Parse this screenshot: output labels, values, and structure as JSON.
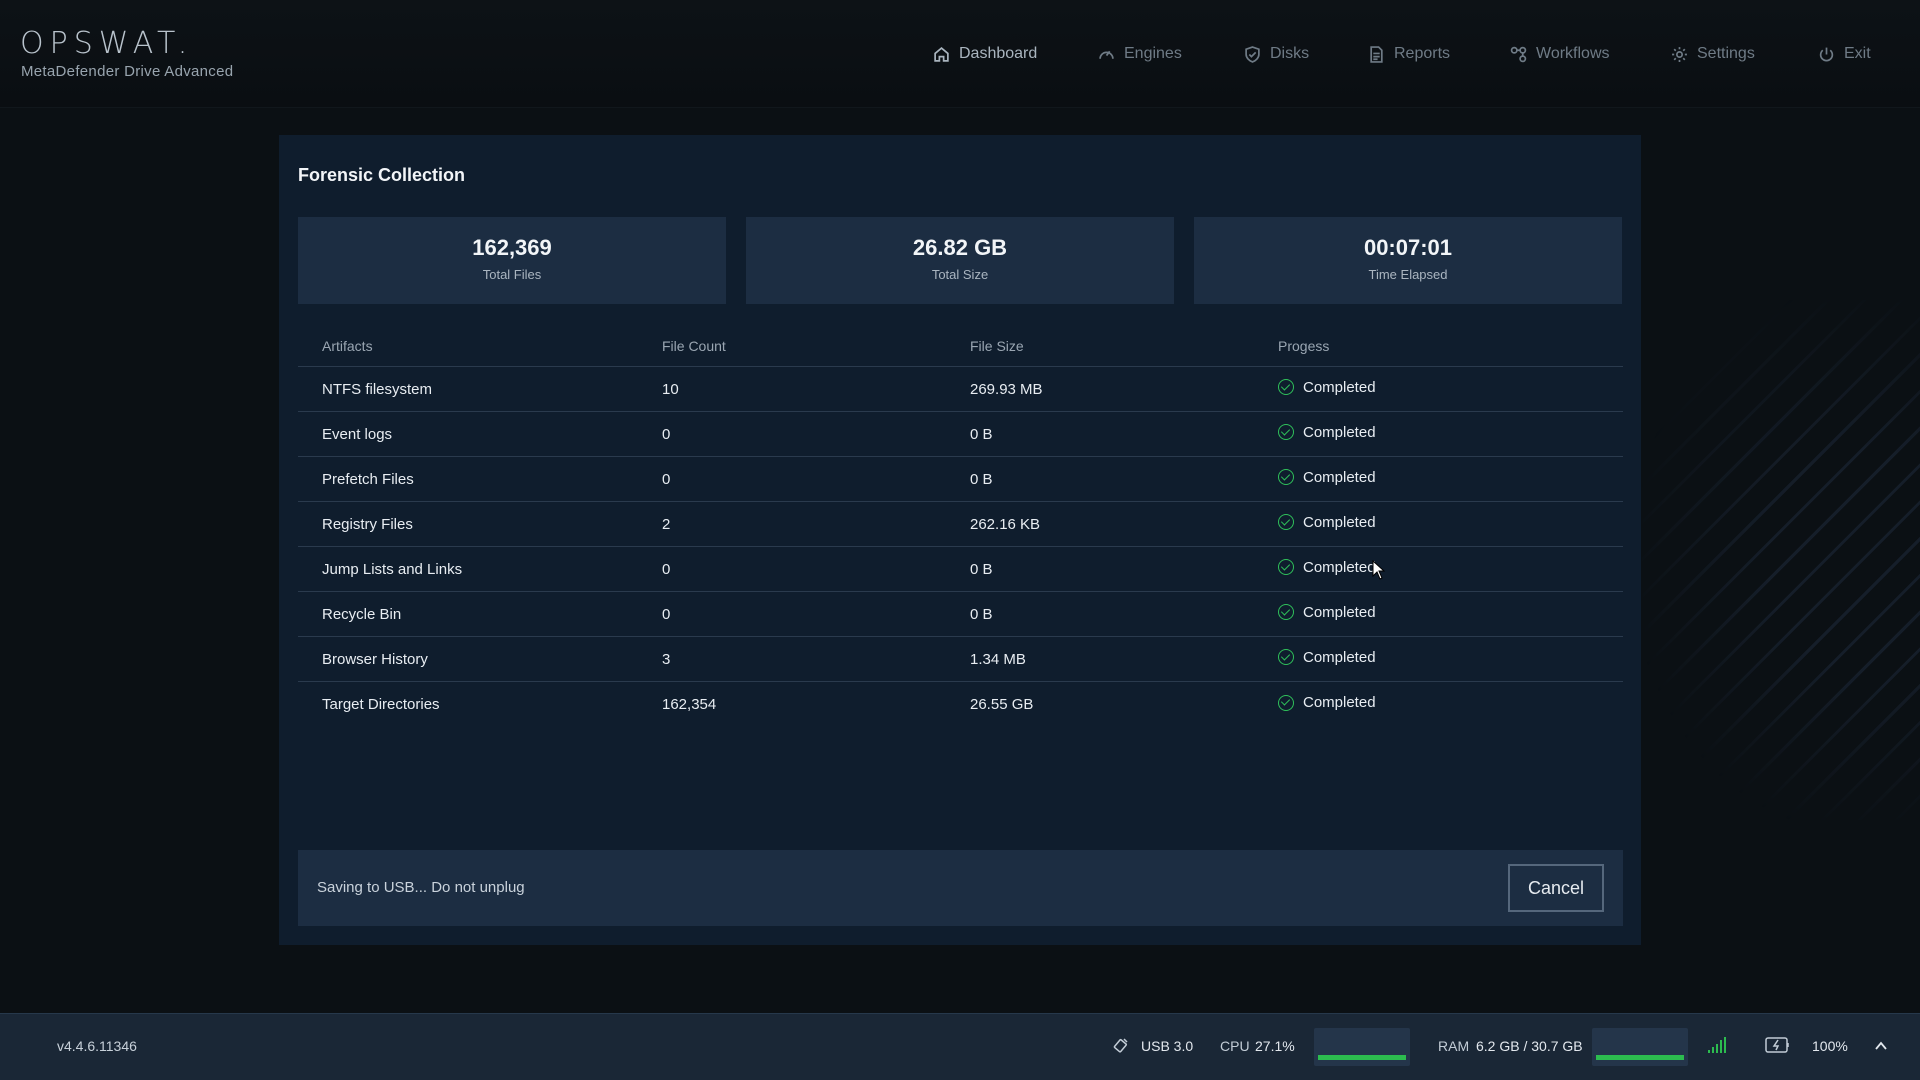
{
  "app": {
    "logo": "OPSWAT.",
    "subtitle": "MetaDefender Drive Advanced"
  },
  "nav": [
    {
      "label": "Dashboard",
      "icon": "home-icon",
      "active": true
    },
    {
      "label": "Engines",
      "icon": "gauge-icon",
      "active": false
    },
    {
      "label": "Disks",
      "icon": "shield-check-icon",
      "active": false
    },
    {
      "label": "Reports",
      "icon": "document-icon",
      "active": false
    },
    {
      "label": "Workflows",
      "icon": "workflow-icon",
      "active": false
    },
    {
      "label": "Settings",
      "icon": "gear-icon",
      "active": false
    },
    {
      "label": "Exit",
      "icon": "power-icon",
      "active": false
    }
  ],
  "panel": {
    "title": "Forensic Collection",
    "stats": [
      {
        "value": "162,369",
        "label": "Total Files"
      },
      {
        "value": "26.82 GB",
        "label": "Total Size"
      },
      {
        "value": "00:07:01",
        "label": "Time Elapsed"
      }
    ],
    "table": {
      "headers": [
        "Artifacts",
        "File Count",
        "File Size",
        "Progess"
      ],
      "rows": [
        {
          "artifact": "NTFS filesystem",
          "count": "10",
          "size": "269.93 MB",
          "status": "Completed"
        },
        {
          "artifact": "Event logs",
          "count": "0",
          "size": "0 B",
          "status": "Completed"
        },
        {
          "artifact": "Prefetch Files",
          "count": "0",
          "size": "0 B",
          "status": "Completed"
        },
        {
          "artifact": "Registry Files",
          "count": "2",
          "size": "262.16 KB",
          "status": "Completed"
        },
        {
          "artifact": "Jump Lists and Links",
          "count": "0",
          "size": "0 B",
          "status": "Completed"
        },
        {
          "artifact": "Recycle Bin",
          "count": "0",
          "size": "0 B",
          "status": "Completed"
        },
        {
          "artifact": "Browser History",
          "count": "3",
          "size": "1.34 MB",
          "status": "Completed"
        },
        {
          "artifact": "Target Directories",
          "count": "162,354",
          "size": "26.55 GB",
          "status": "Completed"
        }
      ]
    },
    "footer": {
      "message": "Saving to USB... Do not unplug",
      "cancel_label": "Cancel"
    }
  },
  "statusbar": {
    "version": "v4.4.6.11346",
    "usb": "USB 3.0",
    "cpu_label": "CPU",
    "cpu_value": "27.1%",
    "ram_label": "RAM",
    "ram_value": "6.2 GB / 30.7 GB",
    "battery": "100%"
  },
  "colors": {
    "background": "#0b1014",
    "panel": "#0f1d2d",
    "card": "#1c2d42",
    "success": "#2fbf5a"
  }
}
